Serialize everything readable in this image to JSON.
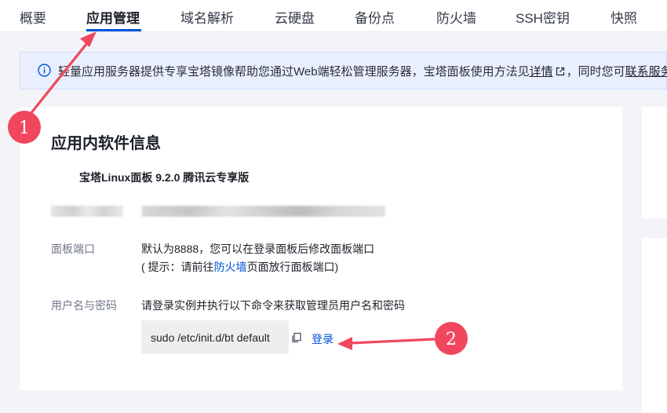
{
  "tabs": [
    {
      "label": "概要"
    },
    {
      "label": "应用管理"
    },
    {
      "label": "域名解析"
    },
    {
      "label": "云硬盘"
    },
    {
      "label": "备份点"
    },
    {
      "label": "防火墙"
    },
    {
      "label": "SSH密钥"
    },
    {
      "label": "快照"
    }
  ],
  "notice": {
    "text_before": "轻量应用服务器提供专享宝塔镜像帮助您通过Web端轻松管理服务器，宝塔面板使用方法见",
    "link1": "详情",
    "text_middle": "，同时您可",
    "link2": "联系服务",
    "icon": "info-icon"
  },
  "card": {
    "title": "应用内软件信息",
    "product": "宝塔Linux面板 9.2.0 腾讯云专享版",
    "port_label": "面板端口",
    "port_line1": "默认为8888，您可以在登录面板后修改面板端口",
    "port_line2_pre": "( 提示：请前往",
    "port_line2_link": "防火墙",
    "port_line2_post": "页面放行面板端口)",
    "cred_label": "用户名与密码",
    "cred_text": "请登录实例并执行以下命令来获取管理员用户名和密码",
    "command": "sudo /etc/init.d/bt default",
    "login": "登录"
  },
  "annotations": {
    "badge1": "1",
    "badge2": "2",
    "color": "#f0475e"
  },
  "colors": {
    "accent": "#0052d9",
    "notice_bg": "#e9effe",
    "annotation": "#f0475e"
  }
}
